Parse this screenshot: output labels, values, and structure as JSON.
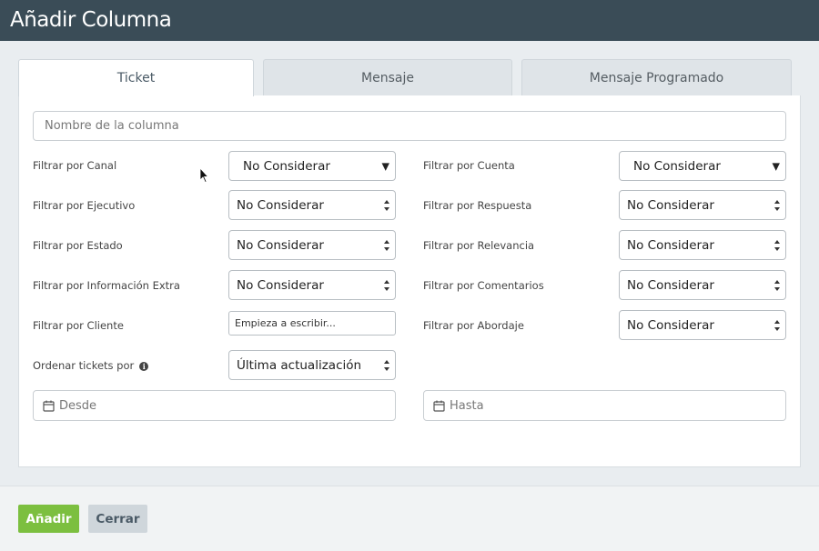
{
  "header": {
    "title": "Añadir Columna"
  },
  "tabs": [
    {
      "label": "Ticket",
      "active": true
    },
    {
      "label": "Mensaje",
      "active": false
    },
    {
      "label": "Mensaje Programado",
      "active": false
    }
  ],
  "form": {
    "name_placeholder": "Nombre de la columna",
    "left": [
      {
        "label": "Filtrar por Canal",
        "value": "No Considerar"
      },
      {
        "label": "Filtrar por Ejecutivo",
        "value": "No Considerar"
      },
      {
        "label": "Filtrar por Estado",
        "value": "No Considerar"
      },
      {
        "label": "Filtrar por Información Extra",
        "value": "No Considerar"
      },
      {
        "label": "Filtrar por Cliente",
        "placeholder": "Empieza a escribir..."
      },
      {
        "label": "Ordenar tickets por",
        "value": "Última actualización"
      }
    ],
    "right": [
      {
        "label": "Filtrar por Cuenta",
        "value": "No Considerar"
      },
      {
        "label": "Filtrar por Respuesta",
        "value": "No Considerar"
      },
      {
        "label": "Filtrar por Relevancia",
        "value": "No Considerar"
      },
      {
        "label": "Filtrar por Comentarios",
        "value": "No Considerar"
      },
      {
        "label": "Filtrar por Abordaje",
        "value": "No Considerar"
      }
    ],
    "from_placeholder": "Desde",
    "to_placeholder": "Hasta"
  },
  "footer": {
    "add_label": "Añadir",
    "close_label": "Cerrar"
  },
  "colors": {
    "header_bg": "#3a4c57",
    "add_button": "#7cbf3f",
    "close_button": "#cfd6db"
  }
}
